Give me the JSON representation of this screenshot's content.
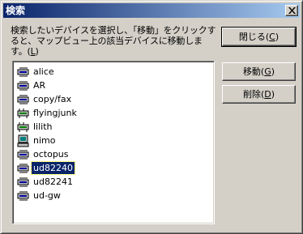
{
  "window": {
    "title": "検索"
  },
  "instruction": {
    "line1": "検索したいデバイスを選択し、「移動」をクリックす",
    "line2": "ると、マップビュー上の該当デバイスに移動しま",
    "line3_prefix": "す。(",
    "line3_key": "L",
    "line3_suffix": ")"
  },
  "buttons": {
    "close": {
      "prefix": "閉じる(",
      "key": "C",
      "suffix": ")"
    },
    "move": {
      "prefix": "移動(",
      "key": "G",
      "suffix": ")"
    },
    "delete": {
      "prefix": "削除(",
      "key": "D",
      "suffix": ")"
    }
  },
  "devices": [
    {
      "label": "alice",
      "icon": "router-icon"
    },
    {
      "label": "AR",
      "icon": "router-icon"
    },
    {
      "label": "copy/fax",
      "icon": "router-icon"
    },
    {
      "label": "flyingjunk",
      "icon": "hub-icon"
    },
    {
      "label": "lilith",
      "icon": "hub-icon"
    },
    {
      "label": "nimo",
      "icon": "computer-icon"
    },
    {
      "label": "octopus",
      "icon": "router-icon"
    },
    {
      "label": "ud82240",
      "icon": "router-icon",
      "selected": true
    },
    {
      "label": "ud82241",
      "icon": "router-icon"
    },
    {
      "label": "ud-gw",
      "icon": "router-icon"
    }
  ]
}
